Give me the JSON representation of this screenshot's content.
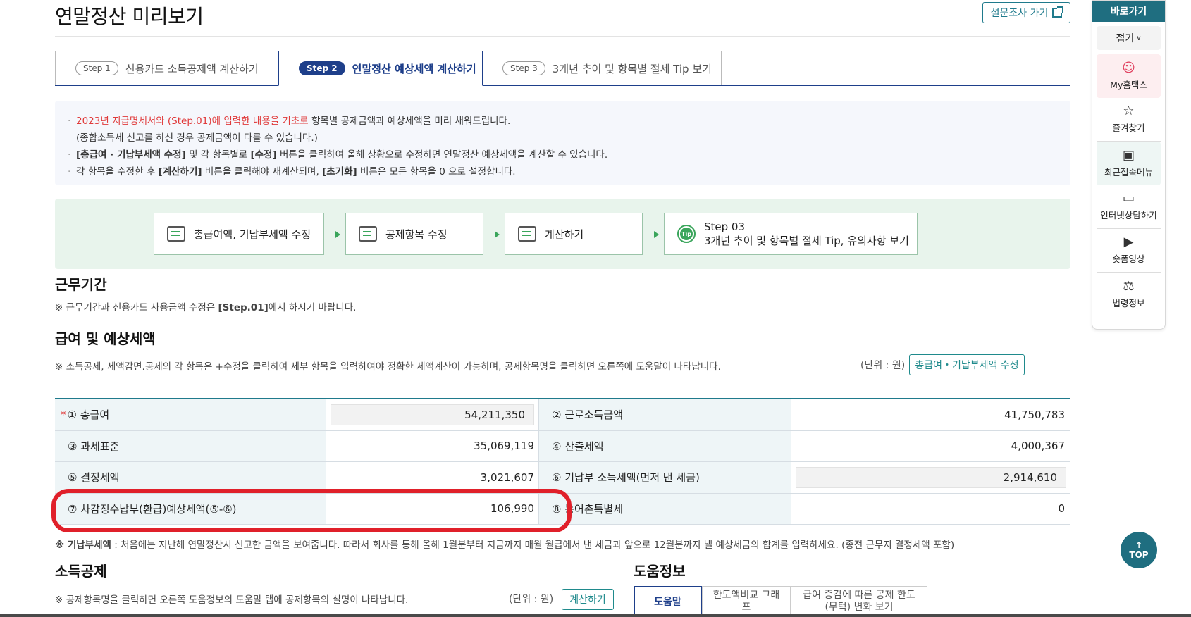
{
  "header": {
    "title": "연말정산 미리보기",
    "survey_label": "설문조사 가기"
  },
  "tabs": [
    {
      "step": "Step 1",
      "label": "신용카드 소득공제액 계산하기",
      "active": false
    },
    {
      "step": "Step 2",
      "label": "연말정산 예상세액 계산하기",
      "active": true
    },
    {
      "step": "Step 3",
      "label": "3개년 추이 및 항목별 절세 Tip 보기",
      "active": false
    }
  ],
  "notice": {
    "l1_red": "2023년 지급명세서와 (Step.01)에 입력한 내용을 기초로",
    "l1_rest": " 항목별 공제금액과 예상세액을 미리 채워드립니다.",
    "l2": "(종합소득세 신고를 하신 경우 공제금액이 다를 수 있습니다.)",
    "l3_b1": "[총급여 · 기납부세액 수정]",
    "l3_m1": " 및 각 항목별로 ",
    "l3_b2": "[수정]",
    "l3_rest": " 버튼을 클릭하여 올해 상황으로 수정하면 연말정산 예상세액을 계산할 수 있습니다.",
    "l4_a": "각 항목을 수정한 후 ",
    "l4_b1": "[계산하기]",
    "l4_m": " 버튼을 클릭해야 재계산되며, ",
    "l4_b2": "[초기화]",
    "l4_rest": " 버튼은 모든 항목을 0 으로 설정합니다."
  },
  "steps_bar": {
    "s1": "총급여액, 기납부세액 수정",
    "s2": "공제항목 수정",
    "s3": "계산하기",
    "s4_title": "Step 03",
    "s4_sub": "3개년 추이 및 항목별 절세 Tip, 유의사항 보기"
  },
  "work_period": {
    "title": "근무기간",
    "note_a": "※ 근무기간과 신용카드 사용금액 수정은 ",
    "note_b": "[Step.01]",
    "note_c": "에서 하시기 바랍니다."
  },
  "salary": {
    "title": "급여 및 예상세액",
    "note": "※ 소득공제, 세액감면.공제의 각 항목은 +수정을 클릭하여 세부 항목을 입력하여야 정확한 세액계산이 가능하며, 공제항목명을 클릭하면 오른쪽에 도움말이 나타납니다.",
    "unit": "(단위 : 원)",
    "edit_button": "총급여・기납부세액 수정",
    "rows": [
      {
        "l1": "① 총급여",
        "v1": "54,211,350",
        "l2": "② 근로소득금액",
        "v2": "41,750,783"
      },
      {
        "l1": "③ 과세표준",
        "v1": "35,069,119",
        "l2": "④ 산출세액",
        "v2": "4,000,367"
      },
      {
        "l1": "⑤ 결정세액",
        "v1": "3,021,607",
        "l2": "⑥ 기납부 소득세액(먼저 낸 세금)",
        "v2": "2,914,610"
      },
      {
        "l1": "⑦ 차감징수납부(환급)예상세액(⑤-⑥)",
        "v1": "106,990",
        "l2": "⑧ 농어촌특별세",
        "v2": "0"
      }
    ],
    "required_mark": "*",
    "footnote_b": "※ 기납부세액",
    "footnote_rest": " : 처음에는 지난해 연말정산시 신고한 금액을 보여줍니다. 따라서 회사를 통해 올해 1월분부터 지금까지 매월 월급에서 낸 세금과 앞으로 12월분까지 낼 예상세금의 합계를 입력하세요. (종전 근무지 결정세액 포함)"
  },
  "income_deduction": {
    "title": "소득공제",
    "note": "※ 공제항목명을 클릭하면 오른쪽 도움정보의 도움말 탭에 공제항목의 설명이 나타납니다.",
    "unit": "(단위 : 원)",
    "calc_button": "계산하기"
  },
  "help_info": {
    "title": "도움정보",
    "tabs": [
      "도움말",
      "한도액비교 그래프",
      "급여 증감에 따른 공제 한도(무턱) 변화 보기"
    ]
  },
  "quick_menu": {
    "head": "바로가기",
    "fold": "접기",
    "items": [
      {
        "icon": "user-icon",
        "label": "My홈택스"
      },
      {
        "icon": "star-icon",
        "label": "즐겨찾기"
      },
      {
        "icon": "recent-menu-icon",
        "label": "최근접속메뉴"
      },
      {
        "icon": "chat-icon",
        "label": "인터넷상담하기"
      },
      {
        "icon": "play-icon",
        "label": "숏폼영상"
      },
      {
        "icon": "gavel-icon",
        "label": "법령정보"
      }
    ]
  },
  "top_button": "TOP",
  "colors": {
    "accent": "#1f6e80",
    "nav": "#1e3f8a",
    "highlight": "#e0202a",
    "green": "#3aa55b"
  }
}
